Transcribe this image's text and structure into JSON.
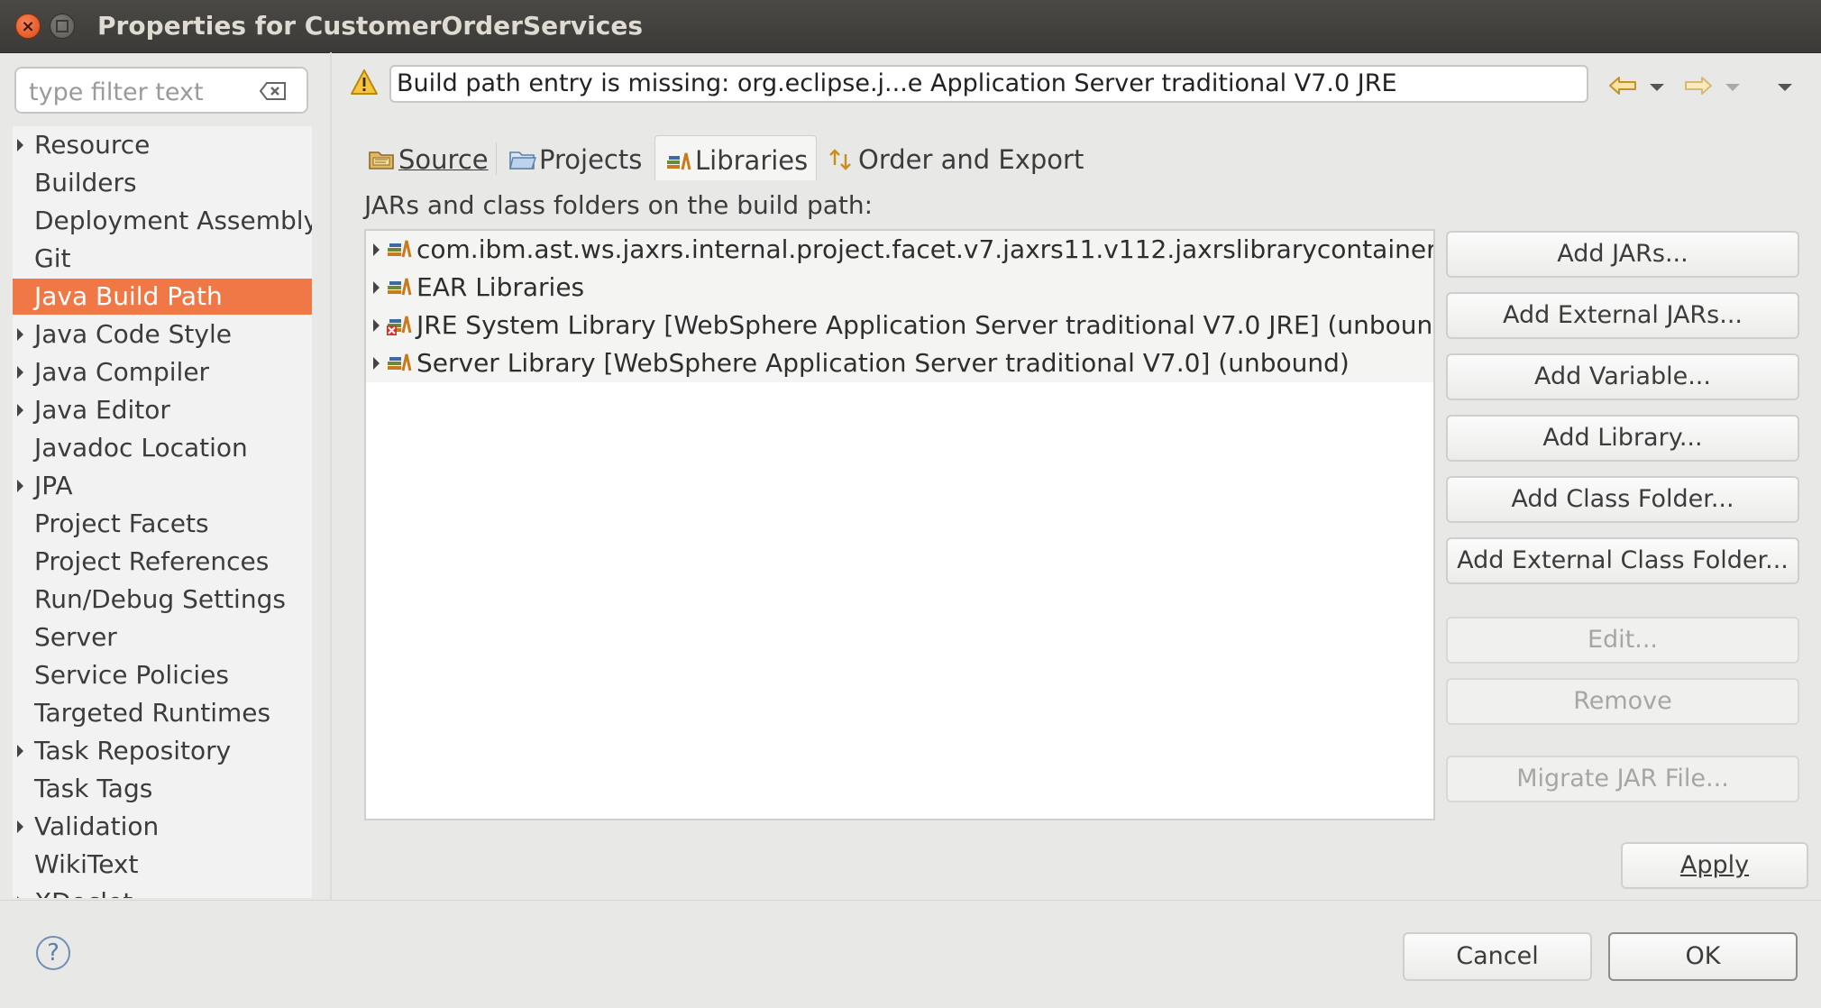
{
  "window": {
    "title": "Properties for CustomerOrderServices"
  },
  "filter": {
    "placeholder": "type filter text",
    "clear_icon": "clear-filter-icon"
  },
  "nav": {
    "items": [
      {
        "label": "Resource",
        "expandable": true
      },
      {
        "label": "Builders",
        "expandable": false
      },
      {
        "label": "Deployment Assembly",
        "expandable": false
      },
      {
        "label": "Git",
        "expandable": false
      },
      {
        "label": "Java Build Path",
        "expandable": false,
        "selected": true
      },
      {
        "label": "Java Code Style",
        "expandable": true
      },
      {
        "label": "Java Compiler",
        "expandable": true
      },
      {
        "label": "Java Editor",
        "expandable": true
      },
      {
        "label": "Javadoc Location",
        "expandable": false
      },
      {
        "label": "JPA",
        "expandable": true
      },
      {
        "label": "Project Facets",
        "expandable": false
      },
      {
        "label": "Project References",
        "expandable": false
      },
      {
        "label": "Run/Debug Settings",
        "expandable": false
      },
      {
        "label": "Server",
        "expandable": false
      },
      {
        "label": "Service Policies",
        "expandable": false
      },
      {
        "label": "Targeted Runtimes",
        "expandable": false
      },
      {
        "label": "Task Repository",
        "expandable": true
      },
      {
        "label": "Task Tags",
        "expandable": false
      },
      {
        "label": "Validation",
        "expandable": true
      },
      {
        "label": "WikiText",
        "expandable": false
      },
      {
        "label": "XDoclet",
        "expandable": true
      }
    ]
  },
  "message": {
    "icon": "warning-icon",
    "text": "Build path entry is missing: org.eclipse.j...e Application Server traditional V7.0 JRE"
  },
  "tabs": {
    "source": "Source",
    "projects": "Projects",
    "libraries": "Libraries",
    "order": "Order and Export"
  },
  "libraries": {
    "section_label": "JARs and class folders on the build path:",
    "entries": [
      {
        "label": "com.ibm.ast.ws.jaxrs.internal.project.facet.v7.jaxrs11.v112.jaxrslibrarycontainer",
        "error": false
      },
      {
        "label": "EAR Libraries",
        "error": false
      },
      {
        "label": "JRE System Library [WebSphere Application Server traditional V7.0 JRE] (unbound)",
        "error": true
      },
      {
        "label": "Server Library [WebSphere Application Server traditional V7.0] (unbound)",
        "error": false
      }
    ]
  },
  "buttons": {
    "add_jars": "Add JARs...",
    "add_external_jars": "Add External JARs...",
    "add_variable": "Add Variable...",
    "add_library": "Add Library...",
    "add_class_folder": "Add Class Folder...",
    "add_external_class_folder": "Add External Class Folder...",
    "edit": "Edit...",
    "remove": "Remove",
    "migrate_jar": "Migrate JAR File...",
    "apply": "Apply",
    "cancel": "Cancel",
    "ok": "OK"
  },
  "help": {
    "label": "?"
  },
  "colors": {
    "selection": "#f07746",
    "title_bar": "#3c3b37",
    "close_button": "#e95420"
  }
}
